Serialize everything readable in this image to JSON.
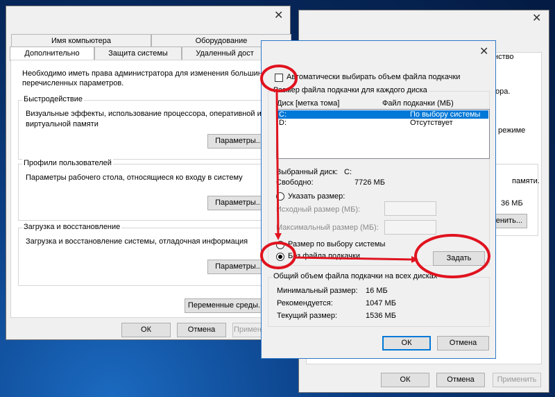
{
  "colors": {
    "annotation": "#e0131f",
    "selection": "#0078d7",
    "desktop": "#0b3f86"
  },
  "left_window": {
    "tabs_row1": [
      "Имя компьютера",
      "Оборудование"
    ],
    "tabs_row2": [
      "Дополнительно",
      "Защита системы",
      "Удаленный дост"
    ],
    "intro": "Необходимо иметь права администратора для изменения большин\nперечисленных параметров.",
    "performance": {
      "title": "Быстродействие",
      "text": "Визуальные эффекты, использование процессора, оперативной и\nвиртуальной памяти",
      "button": "Параметры..."
    },
    "profiles": {
      "title": "Профили пользователей",
      "text": "Параметры рабочего стола, относящиеся ко входу в систему",
      "button": "Параметры..."
    },
    "startup": {
      "title": "Загрузка и восстановление",
      "text": "Загрузка и восстановление системы, отладочная информация",
      "button": "Параметры..."
    },
    "env_button": "Переменные среды...",
    "ok": "ОК",
    "cancel": "Отмена",
    "apply": "Примени"
  },
  "right_window": {
    "partial_texts": [
      "нство",
      "ора.",
      "режиме",
      "памяти.",
      "36 МБ",
      "енить..."
    ],
    "ok": "ОК",
    "cancel": "Отмена",
    "apply": "Применить"
  },
  "dialog": {
    "auto_checkbox_label": "Автоматически выбирать объем файла подкачки",
    "per_disk_title": "Размер файла подкачки для каждого диска",
    "col_disk": "Диск [метка тома]",
    "col_size": "Файл подкачки (МБ)",
    "disks": [
      {
        "disk": "C:",
        "size": "По выбору системы",
        "selected": true
      },
      {
        "disk": "D:",
        "size": "Отсутствует",
        "selected": false
      }
    ],
    "selected_disk_label": "Выбранный диск:",
    "selected_disk_value": "C:",
    "free_label": "Свободно:",
    "free_value": "7726 МБ",
    "radio_custom": "Указать размер:",
    "initial_size_label": "Исходный размер (МБ):",
    "max_size_label": "Максимальный размер (МБ):",
    "radio_system": "Размер по выбору системы",
    "radio_none": "Без файла подкачки",
    "set_button": "Задать",
    "total_title": "Общий объем файла подкачки на всех дисках",
    "min_label": "Минимальный размер:",
    "min_value": "16 МБ",
    "recommended_label": "Рекомендуется:",
    "recommended_value": "1047 МБ",
    "current_label": "Текущий размер:",
    "current_value": "1536 МБ",
    "ok": "ОК",
    "cancel": "Отмена"
  }
}
